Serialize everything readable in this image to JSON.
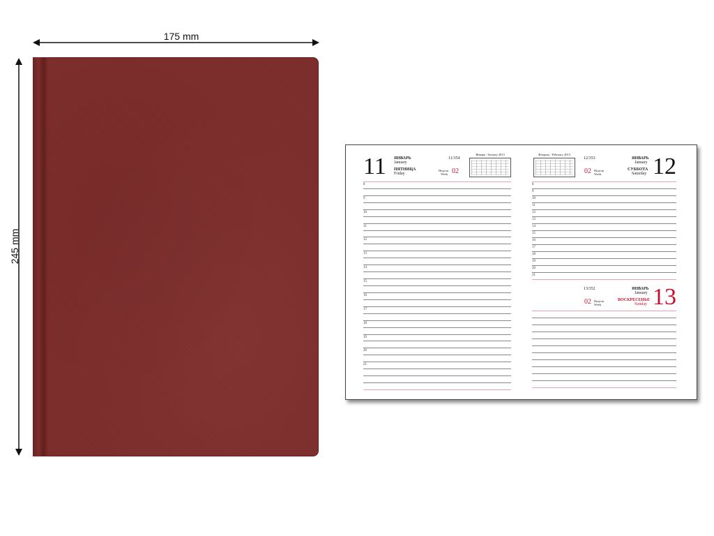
{
  "dimensions": {
    "width": "175 mm",
    "height": "245 mm"
  },
  "cover": {
    "color": "#7e2e2c"
  },
  "diary": {
    "left_page": {
      "day": "11",
      "month_ru": "ЯНВАРЬ",
      "month_en": "January",
      "weekday_ru": "ПЯТНИЦА",
      "weekday_en": "Friday",
      "day_of_year": "11/354",
      "week_label_ru": "Неделя",
      "week_label_en": "Week",
      "week_number": "02",
      "mini_calendar_title": "Январь / January  2013"
    },
    "right_page": {
      "day": "12",
      "month_ru": "ЯНВАРЬ",
      "month_en": "January",
      "weekday_ru": "СУББОТА",
      "weekday_en": "Saturday",
      "day_of_year": "12/353",
      "week_label_ru": "Неделя",
      "week_label_en": "Week",
      "week_number": "02",
      "mini_calendar_title": "Февраль / February  2013",
      "second_day": {
        "day": "13",
        "month_ru": "ЯНВАРЬ",
        "month_en": "January",
        "weekday_ru": "ВОСКРЕСЕНЬЕ",
        "weekday_en": "Sunday",
        "day_of_year": "13/352",
        "week_label_ru": "Неделя",
        "week_label_en": "Week",
        "week_number": "02"
      }
    },
    "hours_left": [
      "8",
      "",
      "9",
      "",
      "10",
      "",
      "11",
      "",
      "12",
      "",
      "13",
      "",
      "14",
      "",
      "15",
      "",
      "16",
      "",
      "17",
      "",
      "18",
      "",
      "19",
      "",
      "20",
      "",
      "21"
    ],
    "hours_right": [
      "8",
      "9",
      "10",
      "11",
      "12",
      "13",
      "14",
      "15",
      "16",
      "17",
      "18",
      "19",
      "20",
      "21"
    ]
  }
}
